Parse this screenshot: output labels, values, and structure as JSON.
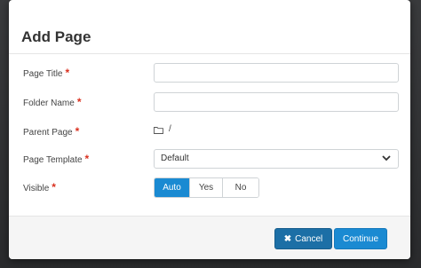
{
  "dialog": {
    "title": "Add Page"
  },
  "form": {
    "page_title": {
      "label": "Page Title",
      "required": "*",
      "value": ""
    },
    "folder_name": {
      "label": "Folder Name",
      "required": "*",
      "value": ""
    },
    "parent_page": {
      "label": "Parent Page",
      "required": "*",
      "value": "/",
      "icon": "folder-icon"
    },
    "page_template": {
      "label": "Page Template",
      "required": "*",
      "selected": "Default",
      "icon": "chevron-down-icon"
    },
    "visible": {
      "label": "Visible",
      "required": "*",
      "options": [
        "Auto",
        "Yes",
        "No"
      ],
      "selected": "Auto"
    }
  },
  "footer": {
    "cancel_label": "Cancel",
    "cancel_icon": "close-icon",
    "continue_label": "Continue"
  },
  "colors": {
    "primary": "#1a8ad2",
    "cancel": "#1c6fa6",
    "required": "#d9301f"
  }
}
